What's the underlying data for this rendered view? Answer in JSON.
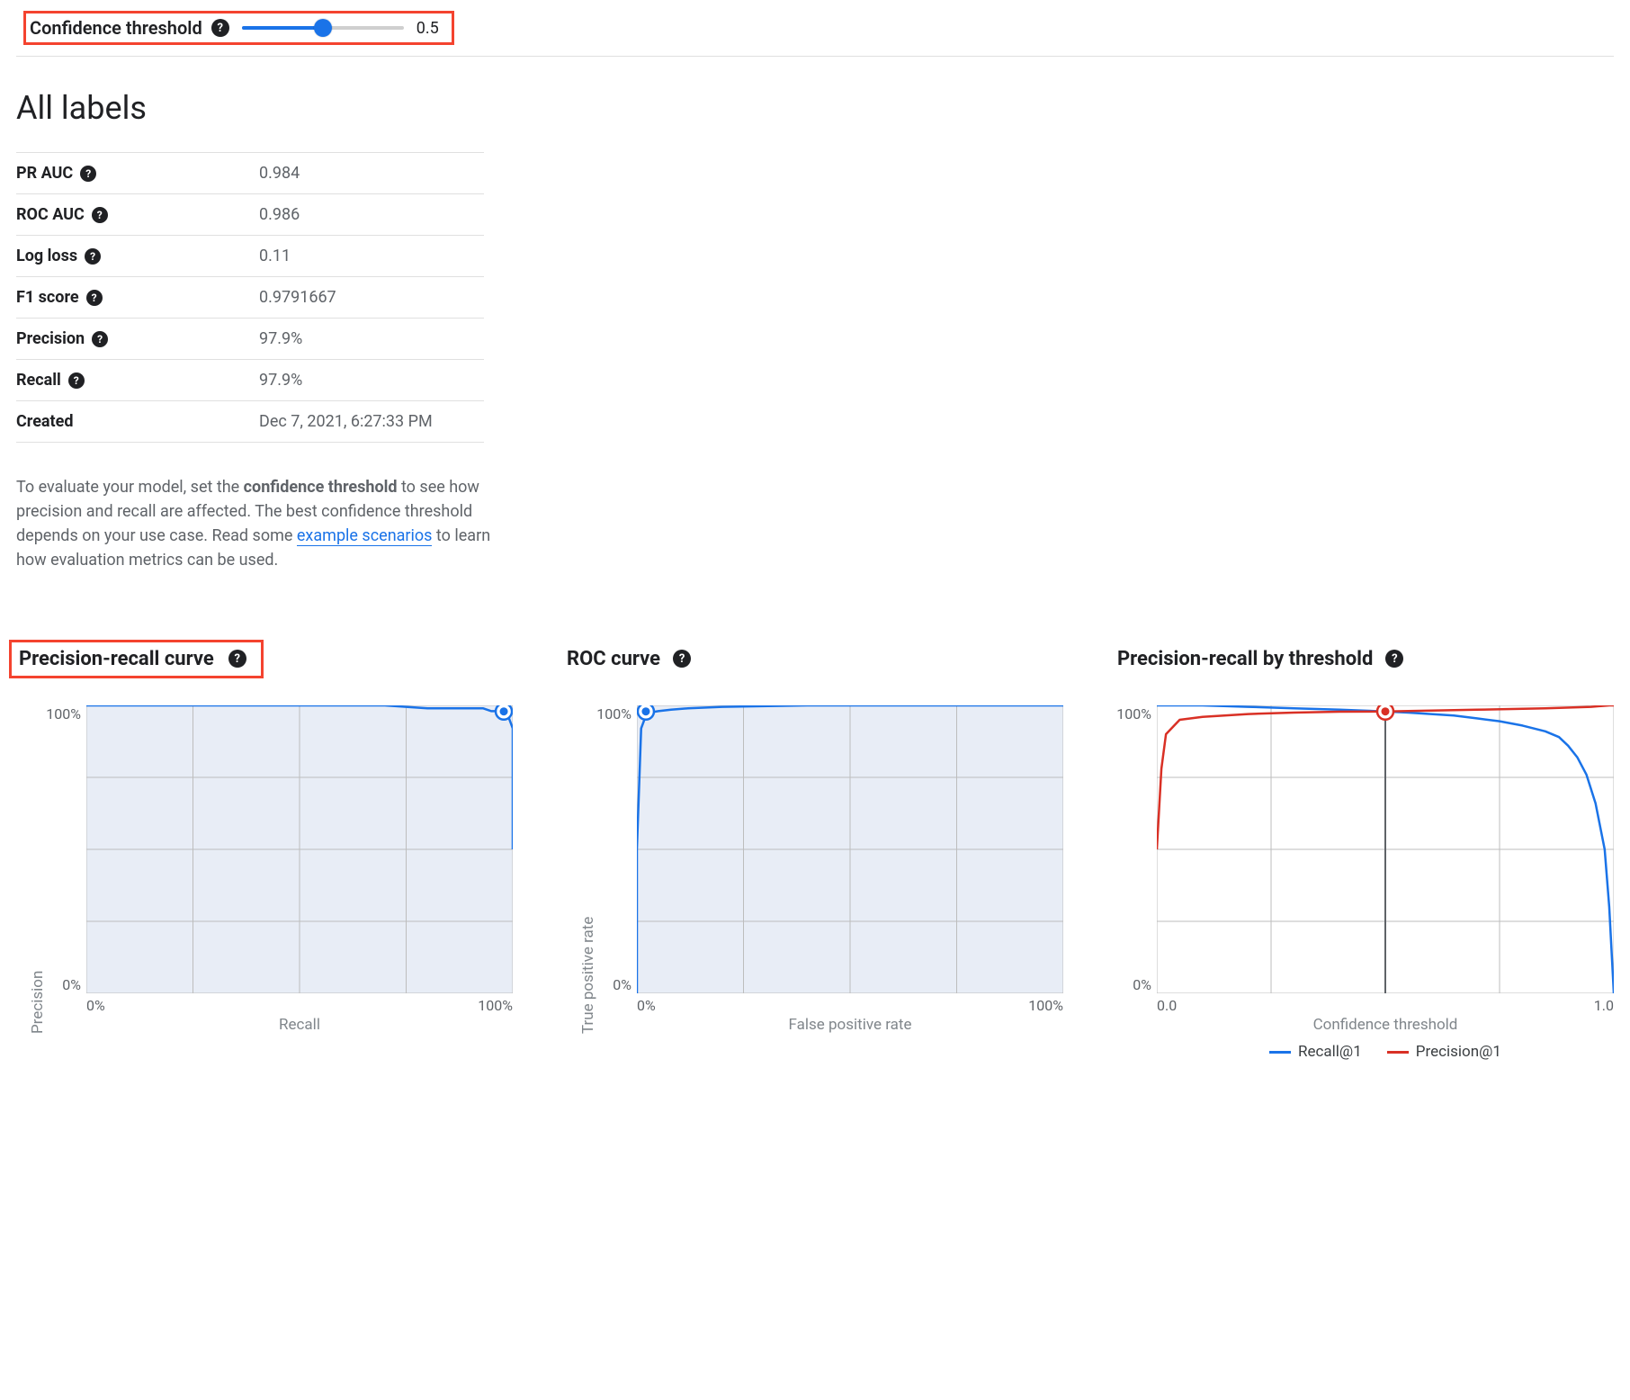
{
  "threshold": {
    "label": "Confidence threshold",
    "value_display": "0.5",
    "value": 0.5,
    "percent": 50
  },
  "section_title": "All labels",
  "metrics": [
    {
      "key": "PR AUC",
      "help": true,
      "value": "0.984"
    },
    {
      "key": "ROC AUC",
      "help": true,
      "value": "0.986"
    },
    {
      "key": "Log loss",
      "help": true,
      "value": "0.11"
    },
    {
      "key": "F1 score",
      "help": true,
      "value": "0.9791667"
    },
    {
      "key": "Precision",
      "help": true,
      "value": "97.9%"
    },
    {
      "key": "Recall",
      "help": true,
      "value": "97.9%"
    },
    {
      "key": "Created",
      "help": false,
      "value": "Dec 7, 2021, 6:27:33 PM"
    }
  ],
  "help_text": {
    "part1": "To evaluate your model, set the ",
    "bold1": "confidence threshold",
    "part2": " to see how precision and recall are affected. The best confidence threshold depends on your use case. Read some ",
    "link_text": "example scenarios",
    "part3": " to learn how evaluation metrics can be used."
  },
  "charts": {
    "pr": {
      "title": "Precision-recall curve",
      "xlabel": "Recall",
      "ylabel": "Precision",
      "xticks": [
        "0%",
        "100%"
      ],
      "yticks": [
        "100%",
        "0%"
      ]
    },
    "roc": {
      "title": "ROC curve",
      "xlabel": "False positive rate",
      "ylabel": "True positive rate",
      "xticks": [
        "0%",
        "100%"
      ],
      "yticks": [
        "100%",
        "0%"
      ]
    },
    "thresh": {
      "title": "Precision-recall by threshold",
      "xlabel": "Confidence threshold",
      "ylabel": "",
      "xticks": [
        "0.0",
        "1.0"
      ],
      "yticks": [
        "100%",
        "0%"
      ],
      "legend": [
        {
          "label": "Recall@1",
          "color": "#1a73e8"
        },
        {
          "label": "Precision@1",
          "color": "#d93025"
        }
      ]
    }
  },
  "colors": {
    "blue": "#1a73e8",
    "red": "#d93025",
    "plot_fill": "#e8edf6",
    "grid": "#bdbdbd",
    "marker_stroke": "#1a73e8"
  },
  "chart_data": [
    {
      "type": "line",
      "title": "Precision-recall curve",
      "xlabel": "Recall",
      "ylabel": "Precision",
      "xlim": [
        0,
        1
      ],
      "ylim": [
        0,
        1
      ],
      "series": [
        {
          "name": "PR",
          "color": "#1a73e8",
          "x": [
            0.0,
            0.2,
            0.4,
            0.6,
            0.7,
            0.8,
            0.85,
            0.9,
            0.93,
            0.95,
            0.97,
            0.979,
            0.99,
            1.0,
            1.0
          ],
          "values": [
            1.0,
            1.0,
            1.0,
            1.0,
            1.0,
            0.99,
            0.99,
            0.99,
            0.99,
            0.98,
            0.98,
            0.979,
            0.96,
            0.92,
            0.5
          ]
        }
      ],
      "marker": {
        "x": 0.979,
        "y": 0.979
      }
    },
    {
      "type": "line",
      "title": "ROC curve",
      "xlabel": "False positive rate",
      "ylabel": "True positive rate",
      "xlim": [
        0,
        1
      ],
      "ylim": [
        0,
        1
      ],
      "series": [
        {
          "name": "ROC",
          "color": "#1a73e8",
          "x": [
            0.0,
            0.0,
            0.01,
            0.02,
            0.03,
            0.05,
            0.08,
            0.12,
            0.2,
            0.4,
            0.7,
            1.0
          ],
          "values": [
            0.0,
            0.5,
            0.92,
            0.96,
            0.975,
            0.98,
            0.985,
            0.99,
            0.995,
            1.0,
            1.0,
            1.0
          ]
        }
      ],
      "marker": {
        "x": 0.021,
        "y": 0.979
      }
    },
    {
      "type": "line",
      "title": "Precision-recall by threshold",
      "xlabel": "Confidence threshold",
      "ylabel": "",
      "xlim": [
        0,
        1
      ],
      "ylim": [
        0,
        1
      ],
      "series": [
        {
          "name": "Recall@1",
          "color": "#1a73e8",
          "x": [
            0.0,
            0.1,
            0.2,
            0.3,
            0.4,
            0.5,
            0.55,
            0.6,
            0.65,
            0.7,
            0.75,
            0.8,
            0.85,
            0.88,
            0.9,
            0.92,
            0.94,
            0.96,
            0.98,
            0.99,
            1.0
          ],
          "values": [
            1.0,
            1.0,
            0.995,
            0.99,
            0.985,
            0.979,
            0.975,
            0.97,
            0.965,
            0.955,
            0.945,
            0.93,
            0.91,
            0.89,
            0.86,
            0.82,
            0.76,
            0.66,
            0.5,
            0.3,
            0.0
          ]
        },
        {
          "name": "Precision@1",
          "color": "#d93025",
          "x": [
            0.0,
            0.01,
            0.02,
            0.05,
            0.1,
            0.2,
            0.3,
            0.4,
            0.5,
            0.7,
            0.85,
            0.95,
            0.99,
            1.0
          ],
          "values": [
            0.5,
            0.78,
            0.9,
            0.95,
            0.96,
            0.97,
            0.975,
            0.978,
            0.979,
            0.985,
            0.99,
            0.995,
            1.0,
            1.0
          ]
        }
      ],
      "marker": {
        "x": 0.5,
        "y": 0.979,
        "vline": true
      }
    }
  ]
}
